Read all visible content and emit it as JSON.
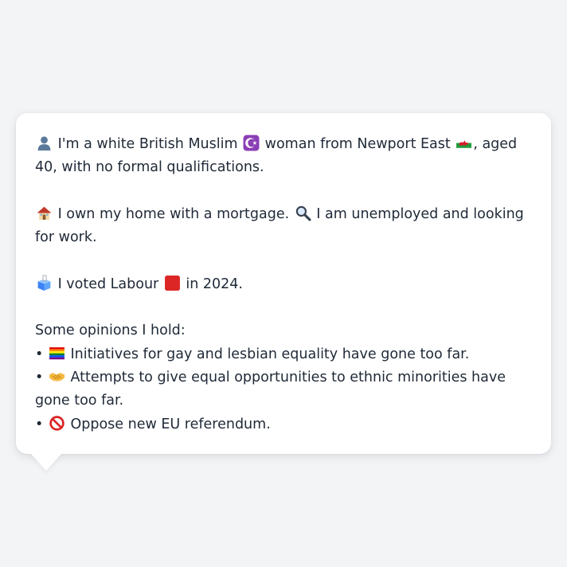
{
  "bio": {
    "line1_a": " I'm a white British Muslim ",
    "line1_b": " woman from Newport East ",
    "line1_c": ", aged 40, with no formal qualifications.",
    "line2_a": " I own my home with a mortgage. ",
    "line2_b": " I am unemployed and looking for work.",
    "line3_a": " I voted Labour ",
    "line3_b": " in 2024."
  },
  "opinions": {
    "heading": "Some opinions I hold:",
    "bullet": "•",
    "items": [
      {
        "icon": "rainbow-flag-icon",
        "text": " Initiatives for gay and lesbian equality have gone too far."
      },
      {
        "icon": "handshake-icon",
        "text": " Attempts to give equal opportunities to ethnic minorities have gone too far."
      },
      {
        "icon": "prohibited-icon",
        "text": " Oppose new EU referendum."
      }
    ]
  },
  "icons": [
    "person-silhouette-icon",
    "star-and-crescent-icon",
    "wales-flag-icon",
    "house-icon",
    "magnifying-glass-icon",
    "ballot-box-icon",
    "red-square-icon",
    "rainbow-flag-icon",
    "handshake-icon",
    "prohibited-icon"
  ],
  "colors": {
    "background": "#f3f4f6",
    "bubble": "#ffffff",
    "text": "#1f2937",
    "labour_red": "#dc2626"
  }
}
